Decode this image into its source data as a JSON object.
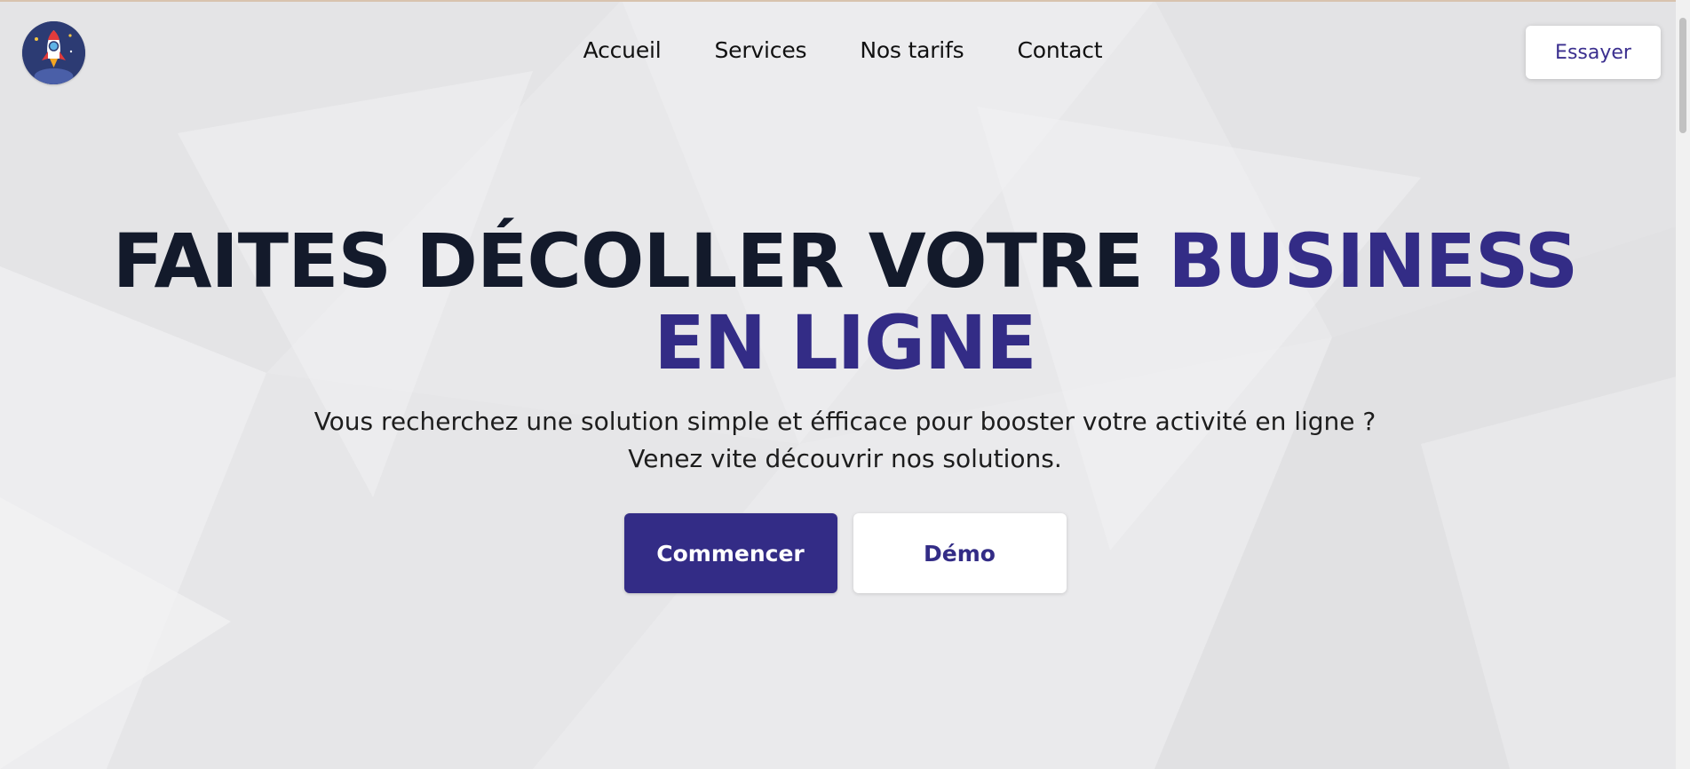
{
  "colors": {
    "accent": "#332c86",
    "title_dark": "#131a2b",
    "background": "#e9e9eb"
  },
  "logo": {
    "icon": "rocket-icon"
  },
  "nav": {
    "items": [
      {
        "label": "Accueil"
      },
      {
        "label": "Services"
      },
      {
        "label": "Nos tarifs"
      },
      {
        "label": "Contact"
      }
    ],
    "try_label": "Essayer"
  },
  "hero": {
    "title_part1": "FAITES DÉCOLLER VOTRE",
    "title_part2": "BUSINESS EN LIGNE",
    "subtitle_line1": "Vous recherchez une solution simple et éfficace pour booster votre activité en ligne ?",
    "subtitle_line2": "Venez vite découvrir nos solutions.",
    "primary_label": "Commencer",
    "secondary_label": "Démo"
  }
}
